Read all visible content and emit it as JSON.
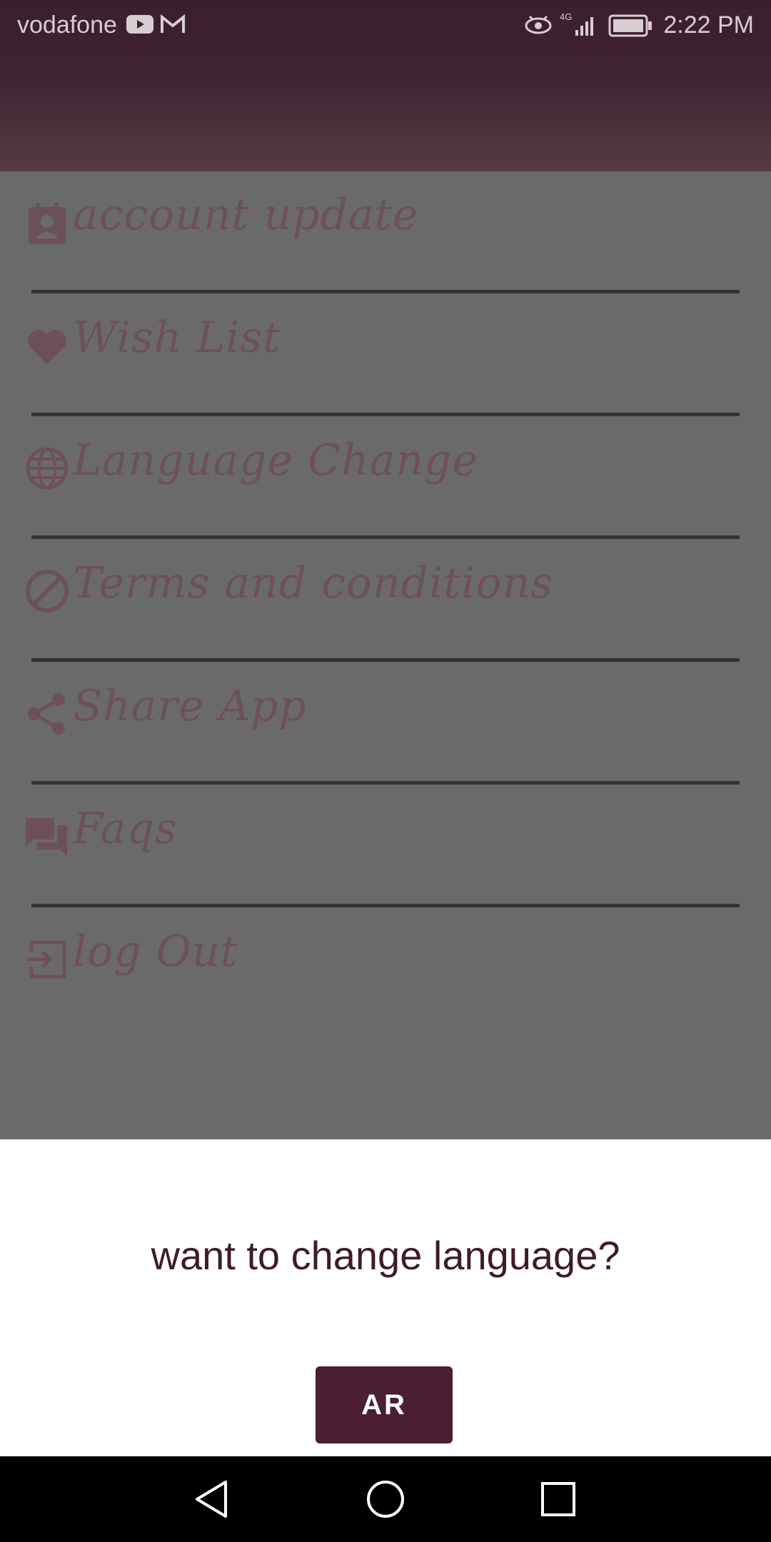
{
  "status_bar": {
    "carrier": "vodafone",
    "network": "4G",
    "time": "2:22 PM",
    "icons": [
      "youtube-icon",
      "gmail-icon",
      "eye-icon",
      "signal-icon",
      "battery-icon"
    ]
  },
  "menu": {
    "items": [
      {
        "label": "account update",
        "icon": "contact-icon"
      },
      {
        "label": "Wish List",
        "icon": "heart-icon"
      },
      {
        "label": "Language Change",
        "icon": "globe-icon"
      },
      {
        "label": "Terms and conditions",
        "icon": "block-icon"
      },
      {
        "label": "Share App",
        "icon": "share-icon"
      },
      {
        "label": "Faqs",
        "icon": "forum-icon"
      },
      {
        "label": "log Out",
        "icon": "logout-icon"
      }
    ]
  },
  "dialog": {
    "question": "want to change language?",
    "button_label": "AR"
  },
  "nav": [
    "back-icon",
    "home-icon",
    "recents-icon"
  ],
  "colors": {
    "primary": "#4b1e33",
    "overlay": "#6a6a6a",
    "menu_text": "#6d5158"
  }
}
